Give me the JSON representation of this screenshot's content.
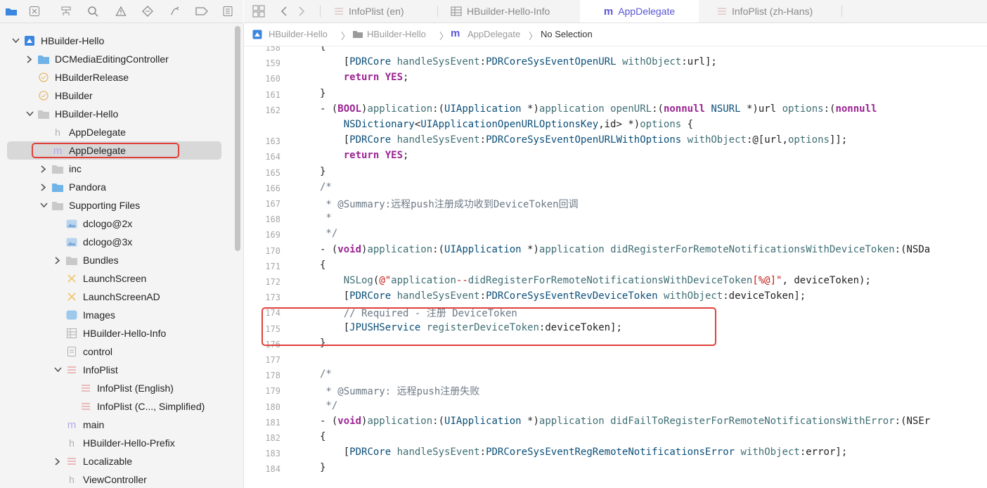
{
  "colors": {
    "accent": "#5a56d6",
    "highlight": "#e0403a",
    "keyword": "#9b2393",
    "method": "#3f6e74",
    "string": "#c41a16",
    "comment": "#6c7986"
  },
  "navigator_toolbar": {
    "icons": [
      "folder-icon",
      "source-control-icon",
      "symbol-hierarchy-icon",
      "find-icon",
      "issue-warning-icon",
      "test-diamond-icon",
      "debug-icon",
      "breakpoint-icon",
      "report-icon"
    ]
  },
  "tabs": [
    {
      "label": "InfoPlist (en)",
      "icon": "strings-icon"
    },
    {
      "label": "HBuilder-Hello-Info",
      "icon": "plist-grid-icon"
    },
    {
      "label": "AppDelegate",
      "icon": "objc-m-icon",
      "active": true
    },
    {
      "label": "InfoPlist (zh-Hans)",
      "icon": "strings-icon"
    }
  ],
  "jumpbar": {
    "project": "HBuilder-Hello",
    "group": "HBuilder-Hello",
    "file": "AppDelegate",
    "selection": "No Selection"
  },
  "tree": [
    {
      "label": "HBuilder-Hello",
      "indent": 0,
      "chev": "down",
      "icon": "project"
    },
    {
      "label": "DCMediaEditingController",
      "indent": 1,
      "chev": "right",
      "icon": "folder"
    },
    {
      "label": "HBuilderRelease",
      "indent": 1,
      "chev": "",
      "icon": "target"
    },
    {
      "label": "HBuilder",
      "indent": 1,
      "chev": "",
      "icon": "target"
    },
    {
      "label": "HBuilder-Hello",
      "indent": 1,
      "chev": "down",
      "icon": "group"
    },
    {
      "label": "AppDelegate",
      "indent": 2,
      "chev": "",
      "icon": "h"
    },
    {
      "label": "AppDelegate",
      "indent": 2,
      "chev": "",
      "icon": "m",
      "selected": true
    },
    {
      "label": "inc",
      "indent": 2,
      "chev": "right",
      "icon": "group"
    },
    {
      "label": "Pandora",
      "indent": 2,
      "chev": "right",
      "icon": "folder"
    },
    {
      "label": "Supporting Files",
      "indent": 2,
      "chev": "down",
      "icon": "group"
    },
    {
      "label": "dclogo@2x",
      "indent": 3,
      "chev": "",
      "icon": "image"
    },
    {
      "label": "dclogo@3x",
      "indent": 3,
      "chev": "",
      "icon": "image"
    },
    {
      "label": "Bundles",
      "indent": 3,
      "chev": "right",
      "icon": "group"
    },
    {
      "label": "LaunchScreen",
      "indent": 3,
      "chev": "",
      "icon": "storyboard"
    },
    {
      "label": "LaunchScreenAD",
      "indent": 3,
      "chev": "",
      "icon": "storyboard"
    },
    {
      "label": "Images",
      "indent": 3,
      "chev": "",
      "icon": "assets"
    },
    {
      "label": "HBuilder-Hello-Info",
      "indent": 3,
      "chev": "",
      "icon": "plist"
    },
    {
      "label": "control",
      "indent": 3,
      "chev": "",
      "icon": "doc"
    },
    {
      "label": "InfoPlist",
      "indent": 3,
      "chev": "down",
      "icon": "strings"
    },
    {
      "label": "InfoPlist (English)",
      "indent": 4,
      "chev": "",
      "icon": "strings"
    },
    {
      "label": "InfoPlist (C..., Simplified)",
      "indent": 4,
      "chev": "",
      "icon": "strings"
    },
    {
      "label": "main",
      "indent": 3,
      "chev": "",
      "icon": "m"
    },
    {
      "label": "HBuilder-Hello-Prefix",
      "indent": 3,
      "chev": "",
      "icon": "h"
    },
    {
      "label": "Localizable",
      "indent": 3,
      "chev": "right",
      "icon": "strings"
    },
    {
      "label": "ViewController",
      "indent": 3,
      "chev": "",
      "icon": "h"
    }
  ],
  "code_lines": [
    {
      "n": "158",
      "t": "{"
    },
    {
      "n": "159",
      "t": "    [PDRCore handleSysEvent:PDRCoreSysEventOpenURL withObject:url];"
    },
    {
      "n": "160",
      "t": "    return YES;"
    },
    {
      "n": "161",
      "t": "}"
    },
    {
      "n": "162",
      "t": "- (BOOL)application:(UIApplication *)application openURL:(nonnull NSURL *)url options:(nonnull"
    },
    {
      "n": "",
      "t": "    NSDictionary<UIApplicationOpenURLOptionsKey,id> *)options {"
    },
    {
      "n": "163",
      "t": "    [PDRCore handleSysEvent:PDRCoreSysEventOpenURLWithOptions withObject:@[url,options]];"
    },
    {
      "n": "164",
      "t": "    return YES;"
    },
    {
      "n": "165",
      "t": "}"
    },
    {
      "n": "166",
      "t": "/*"
    },
    {
      "n": "167",
      "t": " * @Summary:远程push注册成功收到DeviceToken回调"
    },
    {
      "n": "168",
      "t": " *"
    },
    {
      "n": "169",
      "t": " */"
    },
    {
      "n": "170",
      "t": "- (void)application:(UIApplication *)application didRegisterForRemoteNotificationsWithDeviceToken:(NSDa"
    },
    {
      "n": "171",
      "t": "{"
    },
    {
      "n": "172",
      "t": "    NSLog(@\"application--didRegisterForRemoteNotificationsWithDeviceToken[%@]\", deviceToken);"
    },
    {
      "n": "173",
      "t": "    [PDRCore handleSysEvent:PDRCoreSysEventRevDeviceToken withObject:deviceToken];"
    },
    {
      "n": "174",
      "t": "    // Required - 注册 DeviceToken"
    },
    {
      "n": "175",
      "t": "    [JPUSHService registerDeviceToken:deviceToken];"
    },
    {
      "n": "176",
      "t": "}"
    },
    {
      "n": "177",
      "t": ""
    },
    {
      "n": "178",
      "t": "/*"
    },
    {
      "n": "179",
      "t": " * @Summary: 远程push注册失败"
    },
    {
      "n": "180",
      "t": " */"
    },
    {
      "n": "181",
      "t": "- (void)application:(UIApplication *)application didFailToRegisterForRemoteNotificationsWithError:(NSEr"
    },
    {
      "n": "182",
      "t": "{"
    },
    {
      "n": "183",
      "t": "    [PDRCore handleSysEvent:PDRCoreSysEventRegRemoteNotificationsError withObject:error];"
    },
    {
      "n": "184",
      "t": "}"
    }
  ]
}
